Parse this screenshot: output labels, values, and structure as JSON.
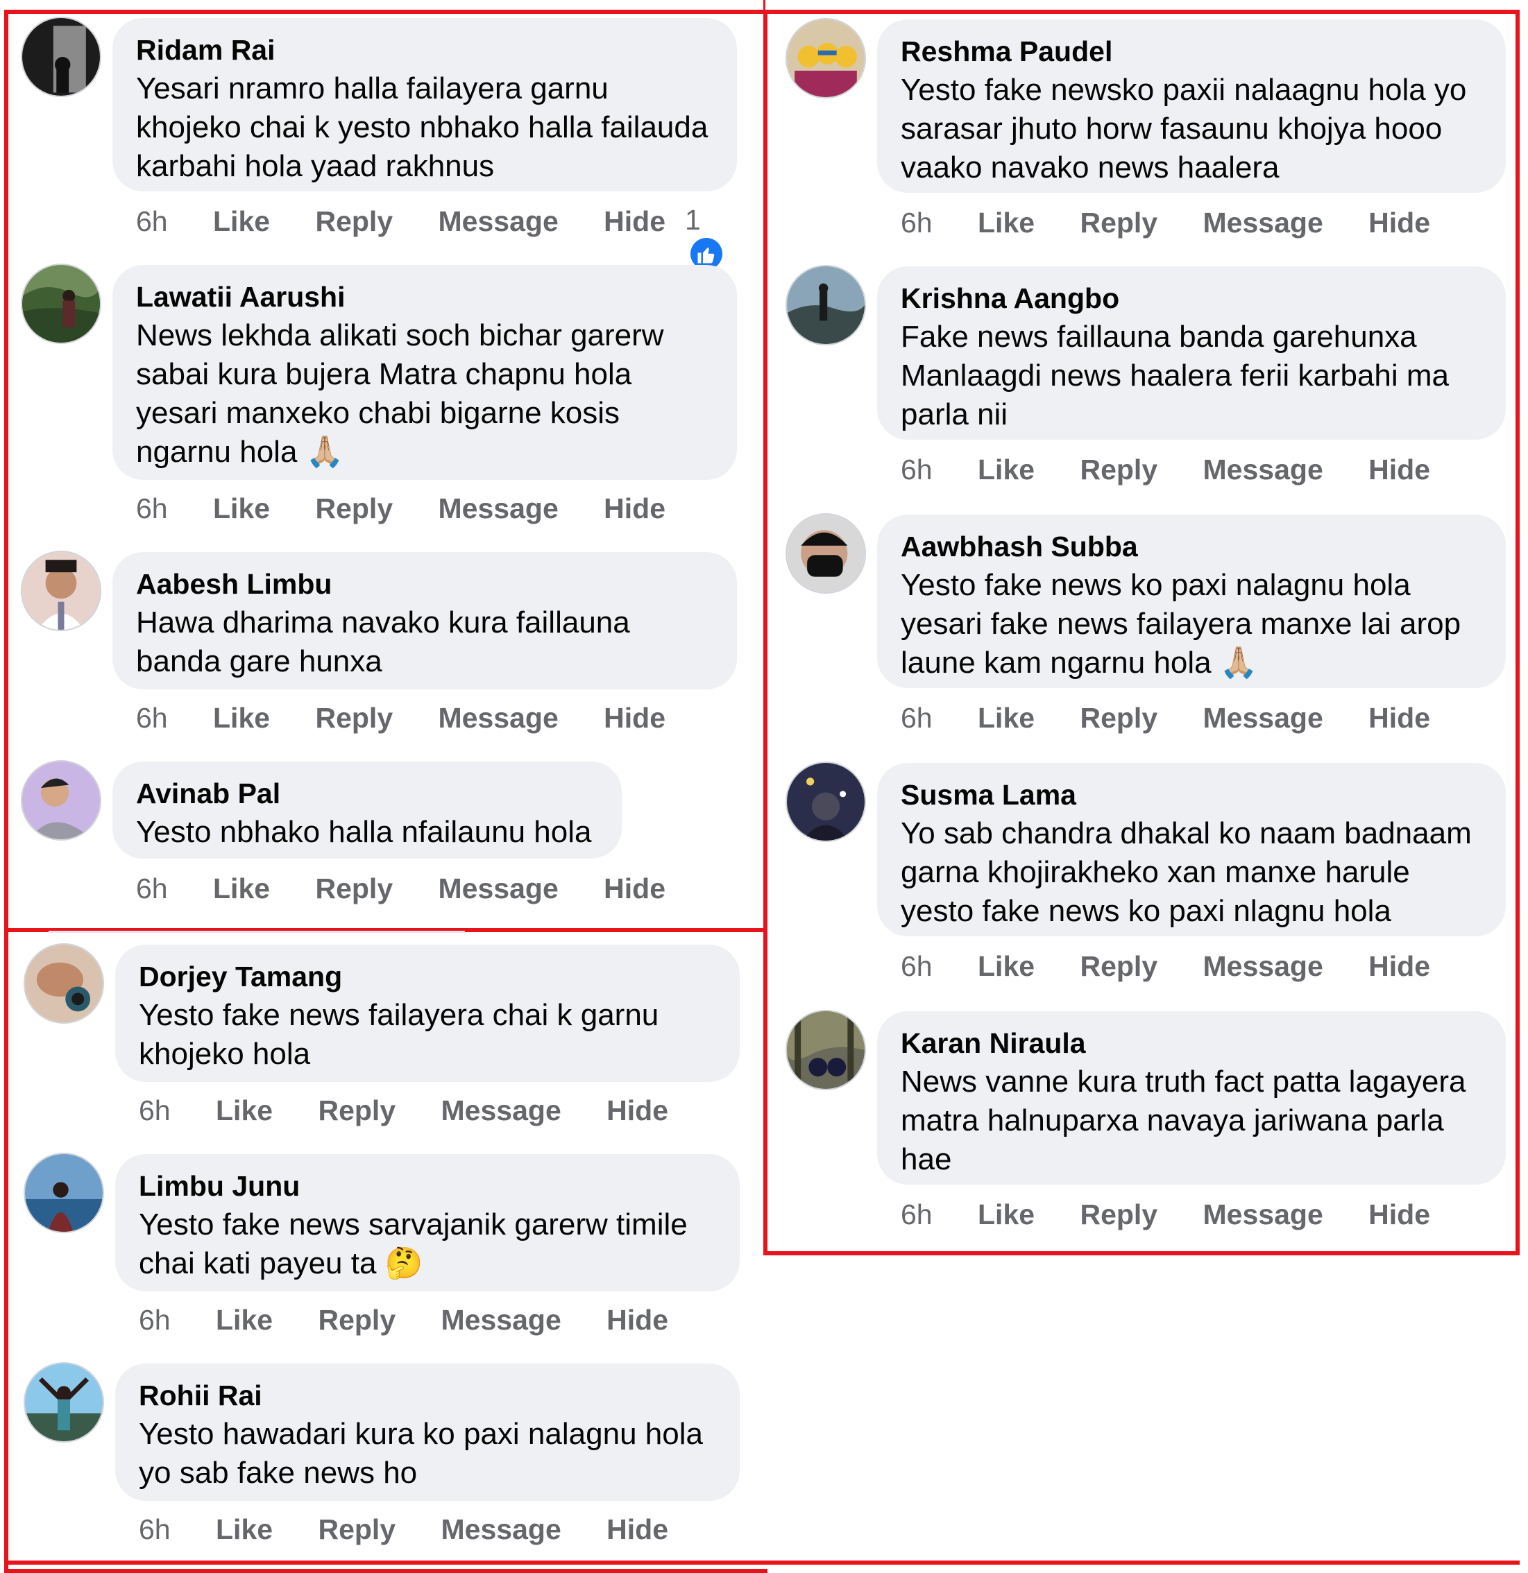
{
  "colors": {
    "frame": "#e8141c",
    "bubble": "#eef0f3",
    "meta": "#65676b",
    "like": "#1877f2"
  },
  "left_comments": [
    {
      "author": "Ridam Rai",
      "text": "Yesari nramro halla failayera garnu khojeko chai k yesto nbhako halla failauda karbahi hola yaad rakhnus",
      "time": "6h",
      "like": "Like",
      "reply": "Reply",
      "message": "Message",
      "hide": "Hide",
      "reactions": "1"
    },
    {
      "author": "Lawatii Aarushi",
      "text": "News lekhda alikati soch bichar garerw sabai kura bujera Matra chapnu hola yesari manxeko chabi bigarne kosis ngarnu hola 🙏🏼",
      "time": "6h",
      "like": "Like",
      "reply": "Reply",
      "message": "Message",
      "hide": "Hide"
    },
    {
      "author": "Aabesh Limbu",
      "text": "Hawa dharima navako kura faillauna banda gare hunxa",
      "time": "6h",
      "like": "Like",
      "reply": "Reply",
      "message": "Message",
      "hide": "Hide"
    },
    {
      "author": "Avinab Pal",
      "text": "Yesto nbhako halla nfailaunu hola",
      "time": "6h",
      "like": "Like",
      "reply": "Reply",
      "message": "Message",
      "hide": "Hide"
    },
    {
      "author": "Dorjey Tamang",
      "text": "Yesto fake news failayera chai k garnu khojeko hola",
      "time": "6h",
      "like": "Like",
      "reply": "Reply",
      "message": "Message",
      "hide": "Hide"
    },
    {
      "author": "Limbu Junu",
      "text": "Yesto fake news sarvajanik garerw timile chai kati payeu ta 🤔",
      "time": "6h",
      "like": "Like",
      "reply": "Reply",
      "message": "Message",
      "hide": "Hide"
    },
    {
      "author": "Rohii Rai",
      "text": "Yesto hawadari kura ko paxi nalagnu hola yo sab fake news ho",
      "time": "6h",
      "like": "Like",
      "reply": "Reply",
      "message": "Message",
      "hide": "Hide"
    }
  ],
  "right_comments": [
    {
      "author": "Reshma Paudel",
      "text": "Yesto fake newsko paxii nalaagnu hola yo sarasar jhuto horw fasaunu khojya hooo vaako navako news haalera",
      "time": "6h",
      "like": "Like",
      "reply": "Reply",
      "message": "Message",
      "hide": "Hide"
    },
    {
      "author": "Krishna Aangbo",
      "text": "Fake news faillauna banda garehunxa Manlaagdi news haalera ferii karbahi ma parla nii",
      "time": "6h",
      "like": "Like",
      "reply": "Reply",
      "message": "Message",
      "hide": "Hide"
    },
    {
      "author": "Aawbhash Subba",
      "text": "Yesto fake news ko paxi nalagnu hola yesari fake news failayera manxe lai arop laune kam ngarnu hola 🙏🏼",
      "time": "6h",
      "like": "Like",
      "reply": "Reply",
      "message": "Message",
      "hide": "Hide"
    },
    {
      "author": "Susma Lama",
      "text": "Yo sab chandra dhakal ko naam badnaam garna khojirakheko xan manxe harule yesto fake news ko paxi nlagnu hola",
      "time": "6h",
      "like": "Like",
      "reply": "Reply",
      "message": "Message",
      "hide": "Hide"
    },
    {
      "author": "Karan Niraula",
      "text": "News vanne kura truth fact patta lagayera matra halnuparxa navaya jariwana parla hae",
      "time": "6h",
      "like": "Like",
      "reply": "Reply",
      "message": "Message",
      "hide": "Hide"
    }
  ]
}
